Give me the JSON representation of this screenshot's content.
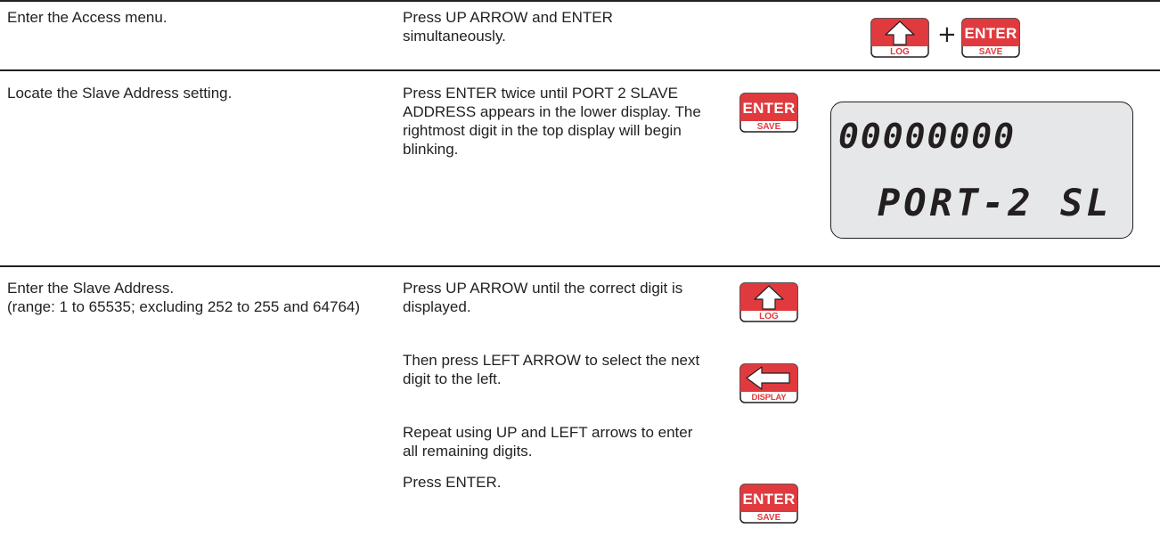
{
  "steps": [
    {
      "action": "Enter the Access menu.",
      "instructions": [
        "Press UP ARROW and ENTER simultaneously."
      ]
    },
    {
      "action": "Locate the Slave Address setting.",
      "instructions": [
        "Press ENTER twice until PORT 2 SLAVE ADDRESS appears in the lower display. The rightmost digit in the top display will begin blinking."
      ]
    },
    {
      "action": "Enter the Slave Address.",
      "action_note": "(range: 1 to 65535; excluding 252 to 255 and 64764)",
      "instructions": [
        "Press UP ARROW until the correct digit is displayed.",
        "Then press LEFT ARROW to select the next digit to the left.",
        "Repeat using UP and LEFT arrows to enter all remaining digits.",
        "Press ENTER."
      ]
    }
  ],
  "keys": {
    "up": {
      "icon": "up-arrow-icon",
      "sublabel": "LOG"
    },
    "enter": {
      "label": "ENTER",
      "sublabel": "SAVE"
    },
    "left": {
      "icon": "left-arrow-icon",
      "sublabel": "DISPLAY"
    }
  },
  "plus_sign": "+",
  "display": {
    "top": "00000000",
    "bottom": "PORT-2 SL"
  },
  "colors": {
    "key_red": "#e03a3e",
    "lcd_background": "#e6e7e8",
    "text": "#231f20"
  }
}
